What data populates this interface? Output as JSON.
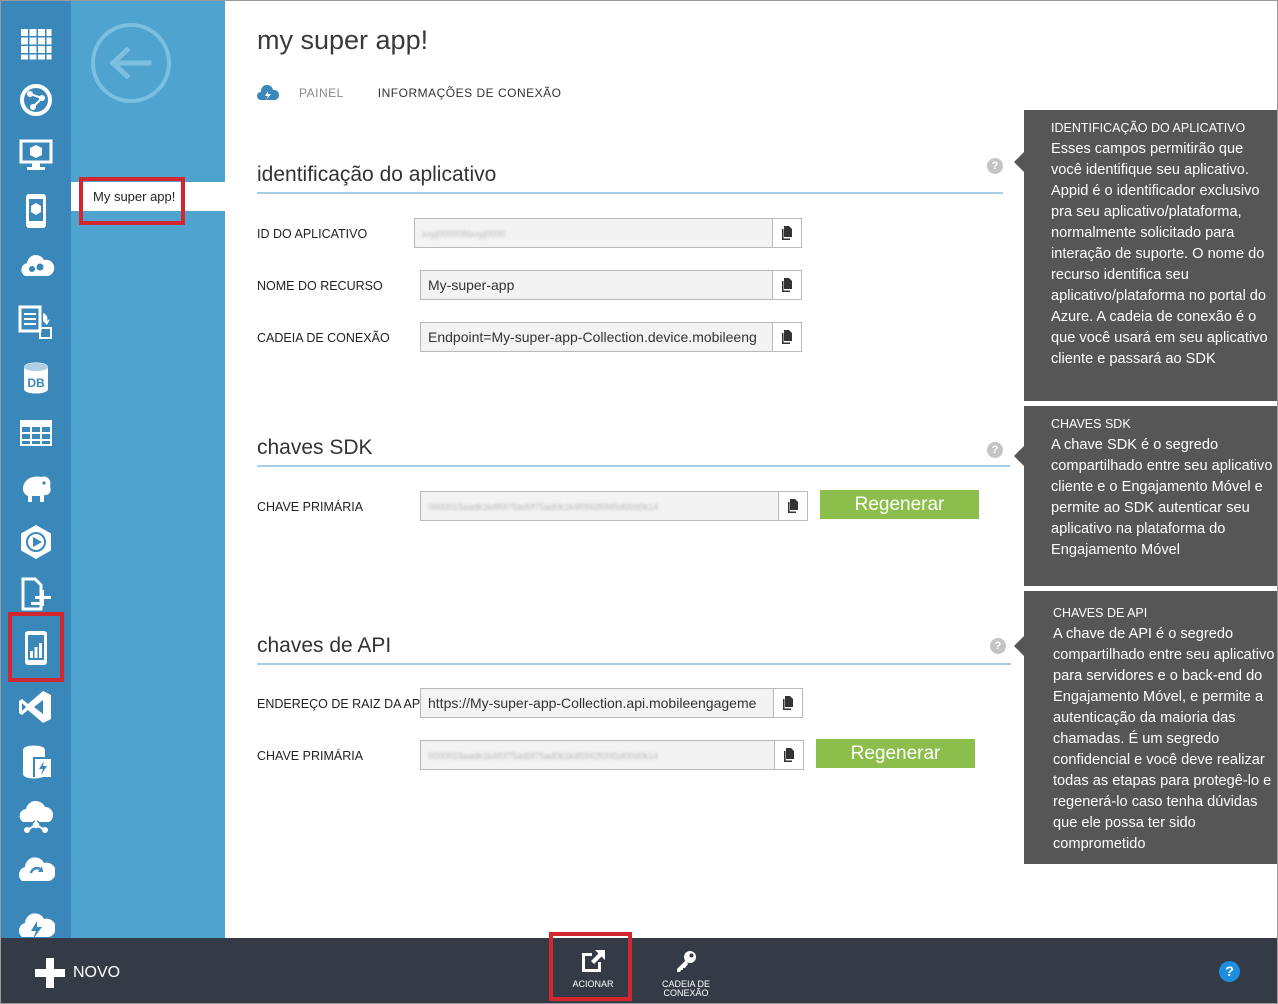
{
  "rail": {
    "items": [
      {
        "icon": "all-items-grid-icon"
      },
      {
        "icon": "web-sites-icon"
      },
      {
        "icon": "virtual-machines-icon"
      },
      {
        "icon": "mobile-services-icon"
      },
      {
        "icon": "cloud-services-icon"
      },
      {
        "icon": "batch-services-icon"
      },
      {
        "icon": "sql-databases-icon"
      },
      {
        "icon": "storage-icon"
      },
      {
        "icon": "hdinsight-icon"
      },
      {
        "icon": "media-services-icon"
      },
      {
        "icon": "service-bus-icon"
      },
      {
        "icon": "mobile-engagement-icon"
      },
      {
        "icon": "visual-studio-online-icon"
      },
      {
        "icon": "cache-icon"
      },
      {
        "icon": "biztalk-services-icon"
      },
      {
        "icon": "recovery-services-icon"
      },
      {
        "icon": "cdn-icon"
      }
    ]
  },
  "subnav": {
    "back_icon": "back-arrow-icon",
    "item_label": "My super app!"
  },
  "header": {
    "title": "my super app!",
    "tabs": [
      {
        "label": "PAINEL",
        "active": false
      },
      {
        "label": "INFORMAÇÕES DE CONEXÃO",
        "active": true
      }
    ]
  },
  "sections": {
    "app_id": {
      "title": "identificação do aplicativo",
      "fields": [
        {
          "label": "ID DO APLICATIVO",
          "value": "xxyj00000fdxxyj0000",
          "blurred": true
        },
        {
          "label": "NOME DO RECURSO",
          "value": "My-super-app",
          "blurred": false
        },
        {
          "label": "CADEIA DE CONEXÃO",
          "value": "Endpoint=My-super-app-Collection.device.mobileeng",
          "blurred": false
        }
      ]
    },
    "sdk_keys": {
      "title": "chaves SDK",
      "fields": [
        {
          "label": "CHAVE PRIMÁRIA",
          "value": "0000015aadk1k4f0f75ad0f75ad0k1k4f0f42f0f45d00d0k14",
          "blurred": true
        }
      ],
      "regen_label": "Regenerar"
    },
    "api_keys": {
      "title": "chaves de API",
      "fields": [
        {
          "label": "ENDEREÇO DE RAIZ DA API",
          "value": "https://My-super-app-Collection.api.mobileengageme",
          "blurred": false
        },
        {
          "label": "CHAVE PRIMÁRIA",
          "value": "0000015aadk1k4f0f75ad0f75ad0k1k4f0f42f0f45d00d0k14",
          "blurred": true
        }
      ],
      "regen_label": "Regenerar"
    }
  },
  "tips": [
    {
      "title": "IDENTIFICAÇÃO DO APLICATIVO",
      "body": "Esses campos permitirão que você identifique seu aplicativo. Appid é o identificador exclusivo pra seu aplicativo/plataforma, normalmente solicitado para interação de suporte. O nome do recurso identifica seu aplicativo/plataforma no portal do Azure. A cadeia de conexão é o que você usará em seu aplicativo cliente e passará ao SDK"
    },
    {
      "title": "CHAVES SDK",
      "body": "A chave SDK é o segredo compartilhado entre seu aplicativo cliente e o Engajamento Móvel e permite ao SDK autenticar seu aplicativo na plataforma do Engajamento Móvel"
    },
    {
      "title": "CHAVES DE API",
      "body": "A chave de API é o segredo compartilhado entre seu aplicativo para servidores e o back-end do Engajamento Móvel, e permite a autenticação da maioria das chamadas. É um segredo confidencial e você deve realizar todas as etapas para protegê-lo e regenerá-lo caso tenha dúvidas que ele possa ter sido comprometido"
    }
  ],
  "bottombar": {
    "new_label": "NOVO",
    "commands": [
      {
        "label": "ACIONAR",
        "icon": "launch-icon"
      },
      {
        "label": "CADEIA DE CONEXÃO",
        "icon": "key-icon"
      }
    ],
    "help_label": "?"
  },
  "colors": {
    "rail": "#3a87b9",
    "subnav": "#4ea3cf",
    "accent_green": "#8cbe4b",
    "bottombar": "#343b46",
    "tooltip": "#565656",
    "highlight_red": "#d3262f"
  }
}
